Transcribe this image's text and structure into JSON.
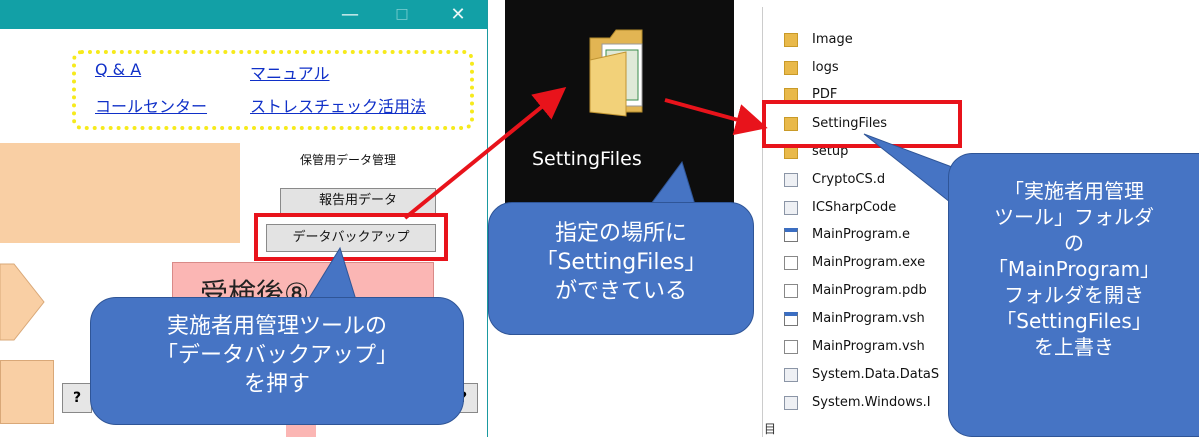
{
  "left_window": {
    "title_controls": {
      "minimize": "—",
      "maximize": "□",
      "close": "✕"
    },
    "links": {
      "qa": "Q & A",
      "manual": "マニュアル",
      "call_center": "コールセンター",
      "stress_check": "ストレスチェック活用法"
    },
    "section_label": "保管用データ管理",
    "report_button": "報告用データ",
    "backup_button": "データバックアップ",
    "pink_panel_text": "受検後⑧",
    "bottom_left_button": "?",
    "bottom_right_button": "?"
  },
  "callout_left": {
    "lines": [
      "実施者用管理ツールの",
      "「データバックアップ」",
      "を押す"
    ]
  },
  "middle": {
    "folder_name": "SettingFiles",
    "callout_lines": [
      "指定の場所に",
      "「SettingFiles」",
      "ができている"
    ]
  },
  "explorer": {
    "items": [
      {
        "name": "Image",
        "icon": "folder-icon"
      },
      {
        "name": "logs",
        "icon": "folder-icon"
      },
      {
        "name": "PDF",
        "icon": "folder-icon"
      },
      {
        "name": "SettingFiles",
        "icon": "folder-icon"
      },
      {
        "name": "setup",
        "icon": "folder-icon"
      },
      {
        "name": "CryptoCS.d",
        "icon": "dll-icon"
      },
      {
        "name": "ICSharpCode",
        "icon": "dll-icon"
      },
      {
        "name": "MainProgram.e",
        "icon": "exe-icon"
      },
      {
        "name": "MainProgram.exe",
        "icon": "file-icon"
      },
      {
        "name": "MainProgram.pdb",
        "icon": "file-icon"
      },
      {
        "name": "MainProgram.vsh",
        "icon": "exe-icon"
      },
      {
        "name": "MainProgram.vsh",
        "icon": "file-icon"
      },
      {
        "name": "System.Data.DataS",
        "icon": "dll-icon"
      },
      {
        "name": "System.Windows.I",
        "icon": "dll-icon"
      }
    ],
    "status_glyph": "目"
  },
  "callout_right": {
    "lines": [
      "「実施者用管理",
      "ツール」フォルダ",
      "の",
      "「MainProgram」",
      "フォルダを開き",
      "「SettingFiles」",
      "を上書き"
    ]
  },
  "colors": {
    "callout": "#4674c4",
    "highlight": "#e8131b",
    "titlebar": "#12a0a6",
    "link_frame": "#f6ea1c"
  }
}
